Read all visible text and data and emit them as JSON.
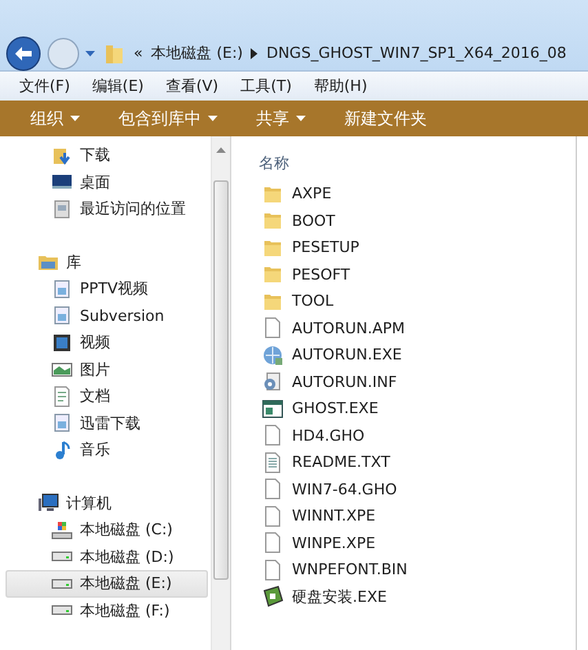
{
  "address_bar": {
    "overflow": "«",
    "segments": [
      "本地磁盘 (E:)",
      "DNGS_GHOST_WIN7_SP1_X64_2016_08"
    ]
  },
  "menu_bar": [
    "文件(F)",
    "编辑(E)",
    "查看(V)",
    "工具(T)",
    "帮助(H)"
  ],
  "toolbar": [
    {
      "label": "组织",
      "dropdown": true
    },
    {
      "label": "包含到库中",
      "dropdown": true
    },
    {
      "label": "共享",
      "dropdown": true
    },
    {
      "label": "新建文件夹",
      "dropdown": false
    }
  ],
  "sidebar": {
    "groups": [
      {
        "children": [
          {
            "label": "下载",
            "kind": "download",
            "selected": false
          },
          {
            "label": "桌面",
            "kind": "desktop",
            "selected": false
          },
          {
            "label": "最近访问的位置",
            "kind": "recent",
            "selected": false
          }
        ]
      },
      {
        "label": "库",
        "kind": "library",
        "children": [
          {
            "label": "PPTV视频",
            "kind": "lib",
            "selected": false
          },
          {
            "label": "Subversion",
            "kind": "lib",
            "selected": false
          },
          {
            "label": "视频",
            "kind": "video",
            "selected": false
          },
          {
            "label": "图片",
            "kind": "picture",
            "selected": false
          },
          {
            "label": "文档",
            "kind": "doc",
            "selected": false
          },
          {
            "label": "迅雷下载",
            "kind": "lib",
            "selected": false
          },
          {
            "label": "音乐",
            "kind": "music",
            "selected": false
          }
        ]
      },
      {
        "label": "计算机",
        "kind": "computer",
        "children": [
          {
            "label": "本地磁盘 (C:)",
            "kind": "sysdrive",
            "selected": false
          },
          {
            "label": "本地磁盘 (D:)",
            "kind": "drive",
            "selected": false
          },
          {
            "label": "本地磁盘 (E:)",
            "kind": "drive",
            "selected": true
          },
          {
            "label": "本地磁盘 (F:)",
            "kind": "drive",
            "selected": false
          }
        ]
      }
    ]
  },
  "file_list": {
    "column": "名称",
    "files": [
      {
        "name": "AXPE",
        "kind": "folder"
      },
      {
        "name": "BOOT",
        "kind": "folder"
      },
      {
        "name": "PESETUP",
        "kind": "folder"
      },
      {
        "name": "PESOFT",
        "kind": "folder"
      },
      {
        "name": "TOOL",
        "kind": "folder"
      },
      {
        "name": "AUTORUN.APM",
        "kind": "file"
      },
      {
        "name": "AUTORUN.EXE",
        "kind": "globe"
      },
      {
        "name": "AUTORUN.INF",
        "kind": "settings"
      },
      {
        "name": "GHOST.EXE",
        "kind": "app"
      },
      {
        "name": "HD4.GHO",
        "kind": "file"
      },
      {
        "name": "README.TXT",
        "kind": "text"
      },
      {
        "name": "WIN7-64.GHO",
        "kind": "file"
      },
      {
        "name": "WINNT.XPE",
        "kind": "file"
      },
      {
        "name": "WINPE.XPE",
        "kind": "file"
      },
      {
        "name": "WNPEFONT.BIN",
        "kind": "file"
      },
      {
        "name": "硬盘安装.EXE",
        "kind": "installer"
      }
    ]
  }
}
